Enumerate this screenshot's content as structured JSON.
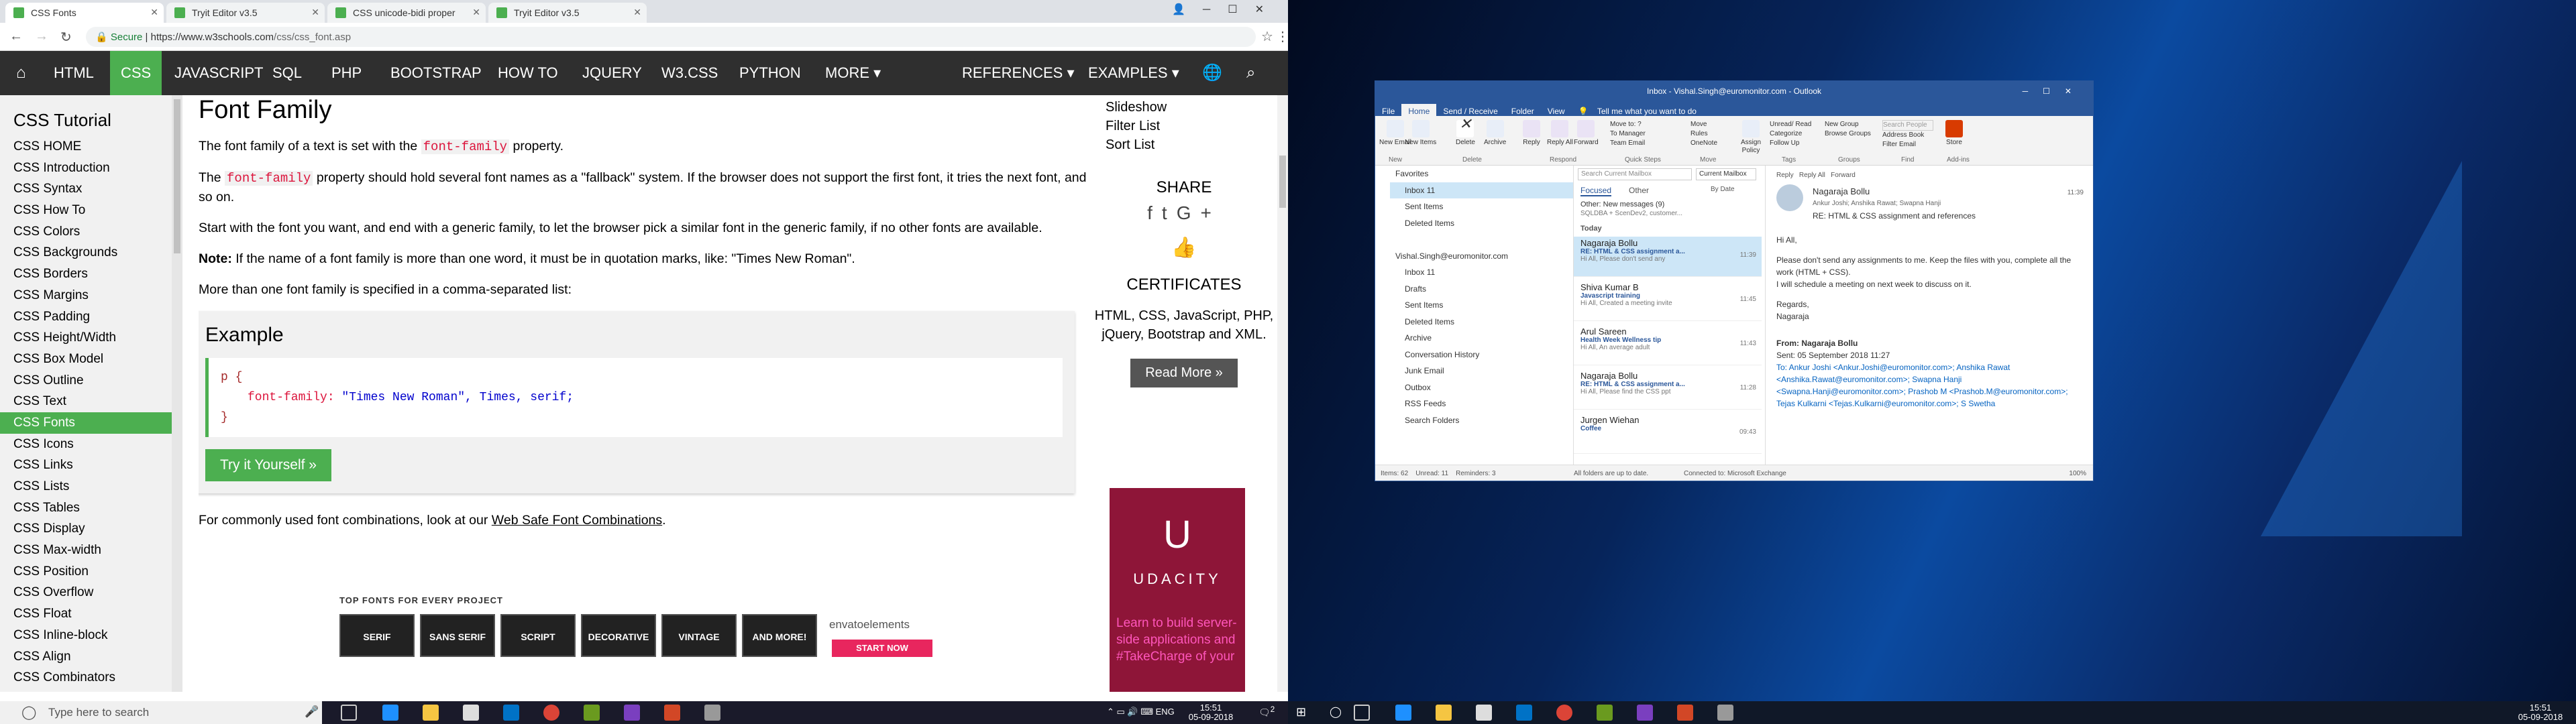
{
  "browser": {
    "tabs": [
      {
        "label": "CSS Fonts",
        "active": true,
        "icon": "w3-favicon"
      },
      {
        "label": "Tryit Editor v3.5",
        "active": false,
        "icon": "w3-favicon"
      },
      {
        "label": "CSS unicode-bidi proper",
        "active": false,
        "icon": "w3-favicon"
      },
      {
        "label": "Tryit Editor v3.5",
        "active": false,
        "icon": "w3-favicon"
      }
    ],
    "secure_label": "Secure",
    "url_domain": "https://www.w3schools.com",
    "url_path": "/css/css_font.asp"
  },
  "w3nav": {
    "items": [
      "HTML",
      "CSS",
      "JAVASCRIPT",
      "SQL",
      "PHP",
      "BOOTSTRAP",
      "HOW TO",
      "JQUERY",
      "W3.CSS",
      "PYTHON",
      "MORE ▾"
    ],
    "active": "CSS",
    "right_items": [
      "REFERENCES ▾",
      "EXAMPLES ▾"
    ]
  },
  "sidebar": {
    "title": "CSS Tutorial",
    "items": [
      "CSS HOME",
      "CSS Introduction",
      "CSS Syntax",
      "CSS How To",
      "CSS Colors",
      "CSS Backgrounds",
      "CSS Borders",
      "CSS Margins",
      "CSS Padding",
      "CSS Height/Width",
      "CSS Box Model",
      "CSS Outline",
      "CSS Text",
      "CSS Fonts",
      "CSS Icons",
      "CSS Links",
      "CSS Lists",
      "CSS Tables",
      "CSS Display",
      "CSS Max-width",
      "CSS Position",
      "CSS Overflow",
      "CSS Float",
      "CSS Inline-block",
      "CSS Align",
      "CSS Combinators"
    ],
    "active": "CSS Fonts"
  },
  "main": {
    "heading": "Font Family",
    "p1_pre": "The font family of a text is set with the ",
    "p1_code": "font-family",
    "p1_post": " property.",
    "p2_pre": "The ",
    "p2_code": "font-family",
    "p2_post": " property should hold several font names as a \"fallback\" system. If the browser does not support the first font, it tries the next font, and so on.",
    "p3": "Start with the font you want, and end with a generic family, to let the browser pick a similar font in the generic family, if no other fonts are available.",
    "note_label": "Note:",
    "note_text": " If the name of a font family is more than one word, it must be in quotation marks, like: \"Times New Roman\".",
    "p4": "More than one font family is specified in a comma-separated list:",
    "example_title": "Example",
    "code_selector": "p {",
    "code_prop": "font-family:",
    "code_val": " \"Times New Roman\", Times, serif;",
    "code_close": "}",
    "try_button": "Try it Yourself »",
    "p5_pre": "For commonly used font combinations, look at our ",
    "p5_link": "Web Safe Font Combinations",
    "p5_post": ".",
    "ad_heading": "TOP FONTS FOR EVERY PROJECT",
    "ad_fonts": [
      "SERIF",
      "SANS SERIF",
      "SCRIPT",
      "DECORATIVE",
      "VINTAGE",
      "AND MORE!"
    ],
    "ad_brand": "envatoelements",
    "ad_cta": "START NOW"
  },
  "right_col": {
    "links": [
      "Slideshow",
      "Filter List",
      "Sort List"
    ],
    "share_heading": "SHARE",
    "share_icons": [
      "facebook-icon",
      "twitter-icon",
      "google-plus-icon"
    ],
    "cert_heading": "CERTIFICATES",
    "cert_text": "HTML, CSS, JavaScript, PHP, jQuery, Bootstrap and XML.",
    "read_more": "Read More »",
    "ad_brand": "UDACITY",
    "ad_text": "Learn to build server-side applications and #TakeCharge of your"
  },
  "taskbar_left": {
    "search_placeholder": "Type here to search",
    "time": "15:51",
    "date": "05-09-2018",
    "notif_count": "2"
  },
  "outlook": {
    "title": "Inbox - Vishal.Singh@euromonitor.com - Outlook",
    "menu": [
      "File",
      "Home",
      "Send / Receive",
      "Folder",
      "View",
      "Tell me what you want to do"
    ],
    "active_menu": "Home",
    "ribbon_buttons": [
      "New Email",
      "New Items",
      "Delete",
      "Archive",
      "Reply",
      "Reply All",
      "Forward",
      "Assign Policy",
      "Unread/ Read",
      "Categorize",
      "Follow Up",
      "Store"
    ],
    "ribbon_small": [
      "Move to: ?",
      "To Manager",
      "Team Email",
      "Move",
      "Rules",
      "OneNote",
      "New Group",
      "Browse Groups",
      "Search People",
      "Address Book",
      "Filter Email"
    ],
    "ribbon_groups": [
      "New",
      "Delete",
      "Respond",
      "Quick Steps",
      "Move",
      "Tags",
      "Groups",
      "Find",
      "Add-ins"
    ],
    "folders": [
      "Favorites",
      "Inbox 11",
      "Sent Items",
      "Deleted Items",
      "",
      "Vishal.Singh@euromonitor.com",
      "Inbox 11",
      "Drafts",
      "Sent Items",
      "Deleted Items",
      "Archive",
      "Conversation History",
      "Junk Email",
      "Outbox",
      "RSS Feeds",
      "Search Folders"
    ],
    "search_placeholder": "Search Current Mailbox",
    "mailbox_scope": "Current Mailbox",
    "list_tabs": [
      "Focused",
      "Other"
    ],
    "sort": "By Date",
    "other_new": "Other: New messages (9)",
    "other_sub": "SQLDBA + ScenDev2, customer...",
    "today_label": "Today",
    "messages": [
      {
        "sender": "Nagaraja Bollu",
        "subject": "RE: HTML & CSS assignment a...",
        "preview": "Hi All,  Please don't send any",
        "time": "11:39"
      },
      {
        "sender": "Shiva Kumar B",
        "subject": "Javascript training",
        "preview": "Hi All,  Created a meeting invite",
        "time": "11:45"
      },
      {
        "sender": "Arul Sareen",
        "subject": "Health Week   Wellness tip",
        "preview": "Hi All,  An average adult",
        "time": "11:43"
      },
      {
        "sender": "Nagaraja Bollu",
        "subject": "RE: HTML & CSS assignment a...",
        "preview": "Hi All,  Please find the CSS ppt",
        "time": "11:28"
      },
      {
        "sender": "Jurgen Wiehan",
        "subject": "Coffee",
        "preview": "",
        "time": "09:43"
      }
    ],
    "reading": {
      "actions": [
        "Reply",
        "Reply All",
        "Forward"
      ],
      "sender": "Nagaraja Bollu",
      "recipients": "Ankur Joshi; Anshika Rawat; Swapna Hanji",
      "time": "11:39",
      "subject": "RE: HTML & CSS assignment and references",
      "body": [
        "Hi All,",
        "Please don't send any assignments to me. Keep the files with you, complete all the work (HTML + CSS).",
        "I will schedule a meeting on next week to discuss on it.",
        "Regards,",
        "Nagaraja"
      ],
      "from_line": "From: Nagaraja Bollu",
      "sent_line": "Sent: 05 September 2018 11:27",
      "to_line": "To: Ankur Joshi <Ankur.Joshi@euromonitor.com>; Anshika Rawat <Anshika.Rawat@euromonitor.com>; Swapna Hanji <Swapna.Hanji@euromonitor.com>; Prashob M <Prashob.M@euromonitor.com>; Tejas Kulkarni <Tejas.Kulkarni@euromonitor.com>; S Swetha"
    },
    "status": [
      "Items: 62",
      "Unread: 11",
      "Reminders: 3",
      "All folders are up to date.",
      "Connected to: Microsoft Exchange",
      "100%"
    ]
  },
  "taskbar_right": {
    "time": "15:51",
    "date": "05-09-2018"
  },
  "colors": {
    "w3_green": "#4caf50",
    "outlook_blue": "#2b579a",
    "code_red": "#dc143c"
  }
}
